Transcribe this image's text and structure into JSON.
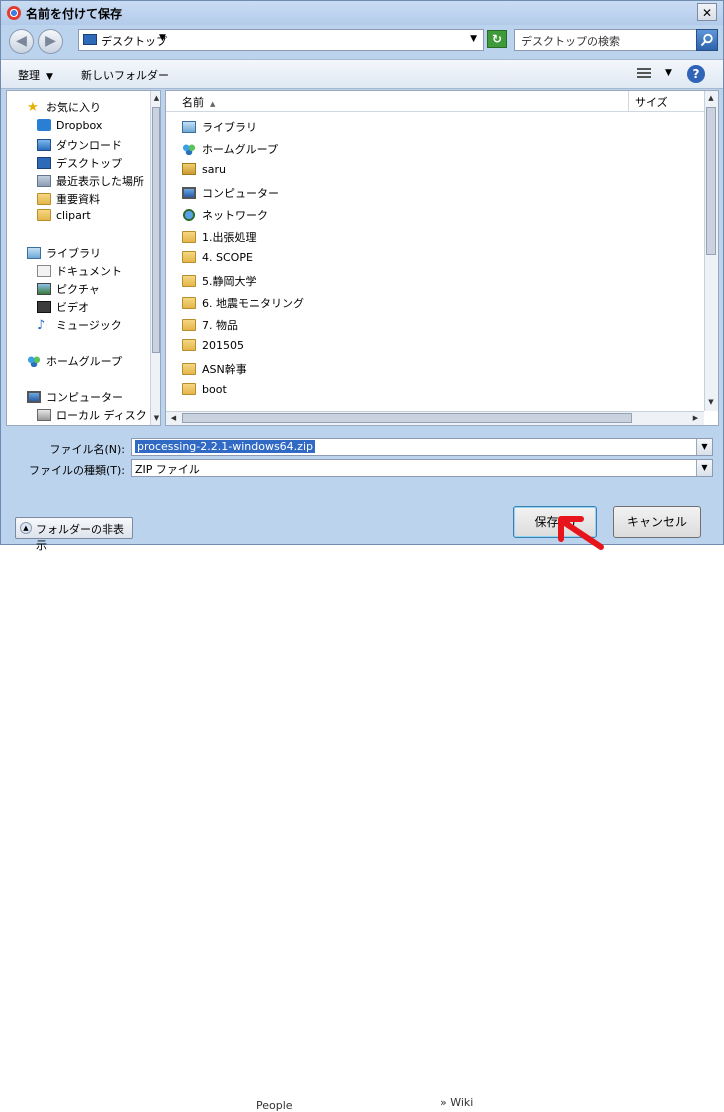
{
  "title": "名前を付けて保存",
  "address": {
    "location": "デスクトップ",
    "search_placeholder": "デスクトップの検索"
  },
  "toolbar": {
    "organize": "整理",
    "new_folder": "新しいフォルダー"
  },
  "nav": {
    "favorites_header": "お気に入り",
    "favorites": [
      "Dropbox",
      "ダウンロード",
      "デスクトップ",
      "最近表示した場所",
      "重要資料",
      "clipart"
    ],
    "libraries_header": "ライブラリ",
    "libraries": [
      "ドキュメント",
      "ピクチャ",
      "ビデオ",
      "ミュージック"
    ],
    "homegroup": "ホームグループ",
    "computer_header": "コンピューター",
    "computer_items": [
      "ローカル ディスク (C"
    ]
  },
  "files": {
    "columns": [
      "名前",
      "サイズ"
    ],
    "rows": [
      {
        "name": "ライブラリ",
        "icon": "library-icon"
      },
      {
        "name": "ホームグループ",
        "icon": "homegroup-icon"
      },
      {
        "name": "saru",
        "icon": "user-folder-icon"
      },
      {
        "name": "コンピューター",
        "icon": "computer-icon"
      },
      {
        "name": "ネットワーク",
        "icon": "network-icon"
      },
      {
        "name": "1.出張処理",
        "icon": "folder-icon"
      },
      {
        "name": "4. SCOPE",
        "icon": "folder-icon"
      },
      {
        "name": "5.静岡大学",
        "icon": "folder-icon"
      },
      {
        "name": "6. 地震モニタリング",
        "icon": "folder-icon"
      },
      {
        "name": "7. 物品",
        "icon": "folder-icon"
      },
      {
        "name": "201505",
        "icon": "folder-icon"
      },
      {
        "name": "ASN幹事",
        "icon": "folder-icon"
      },
      {
        "name": "boot",
        "icon": "folder-icon"
      }
    ]
  },
  "form": {
    "filename_label": "ファイル名(N):",
    "filename_value": "processing-2.2.1-windows64.zip",
    "filetype_label": "ファイルの種類(T):",
    "filetype_value": "ZIP ファイル"
  },
  "buttons": {
    "hide_folders": "フォルダーの非表示",
    "save": "保存(S)",
    "cancel": "キャンセル"
  },
  "background": {
    "text1": "People",
    "text2": "» Wiki"
  },
  "colors": {
    "annotation_arrow": "#e8141c",
    "selection": "#316ac5"
  }
}
